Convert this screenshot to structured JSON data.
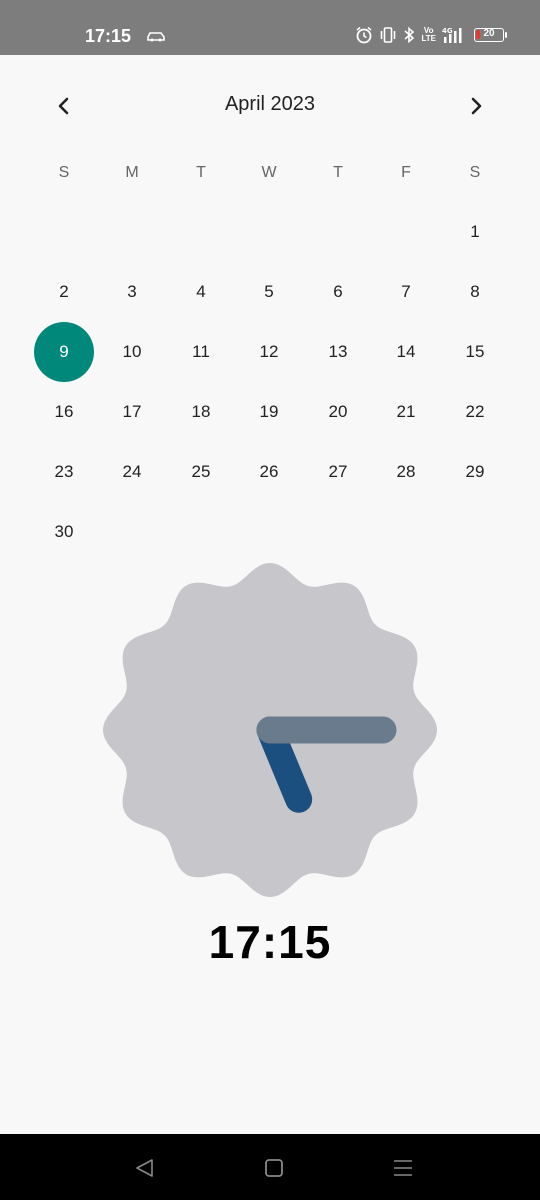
{
  "status_bar": {
    "time": "17:15",
    "lte_label": "Vo\nLTE",
    "network_label": "4G",
    "battery": "20",
    "icons": [
      "car-icon",
      "alarm-icon",
      "vibrate-icon",
      "bluetooth-icon",
      "volte-icon",
      "signal-icon",
      "battery-icon"
    ]
  },
  "calendar": {
    "month_title": "April 2023",
    "weekdays": [
      "S",
      "M",
      "T",
      "W",
      "T",
      "F",
      "S"
    ],
    "selected_day": "9",
    "weeks": [
      [
        "",
        "",
        "",
        "",
        "",
        "",
        "1"
      ],
      [
        "2",
        "3",
        "4",
        "5",
        "6",
        "7",
        "8"
      ],
      [
        "9",
        "10",
        "11",
        "12",
        "13",
        "14",
        "15"
      ],
      [
        "16",
        "17",
        "18",
        "19",
        "20",
        "21",
        "22"
      ],
      [
        "23",
        "24",
        "25",
        "26",
        "27",
        "28",
        "29"
      ],
      [
        "30",
        "",
        "",
        "",
        "",
        "",
        ""
      ]
    ],
    "accent_color": "#00897b"
  },
  "clock": {
    "time_text": "17:15",
    "hour": 17,
    "minute": 15,
    "face_color": "#c6c6cb",
    "hour_hand_color": "#1a4f7f",
    "minute_hand_color": "#6b7b8e"
  },
  "navigation_bar": {
    "icons": [
      "back-icon",
      "home-icon",
      "recents-icon"
    ]
  }
}
